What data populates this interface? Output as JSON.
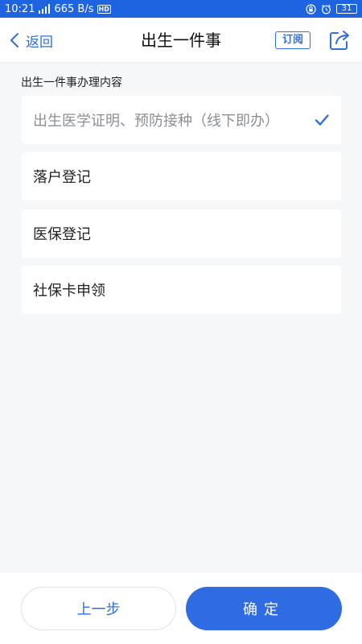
{
  "status_bar": {
    "time": "10:21",
    "network_speed": "665 B/s",
    "hd": "HD",
    "battery": "31"
  },
  "navbar": {
    "back_label": "返回",
    "title": "出生一件事",
    "subscribe_label": "订阅"
  },
  "section": {
    "label": "出生一件事办理内容"
  },
  "items": [
    {
      "label": "出生医学证明、预防接种（线下即办）",
      "selected": true
    },
    {
      "label": "落户登记",
      "selected": false
    },
    {
      "label": "医保登记",
      "selected": false
    },
    {
      "label": "社保卡申领",
      "selected": false
    }
  ],
  "footer": {
    "prev_label": "上一步",
    "confirm_label": "确定"
  },
  "colors": {
    "accent": "#2f6be2",
    "status_bar": "#1e63e0",
    "background": "#f5f7f9"
  }
}
